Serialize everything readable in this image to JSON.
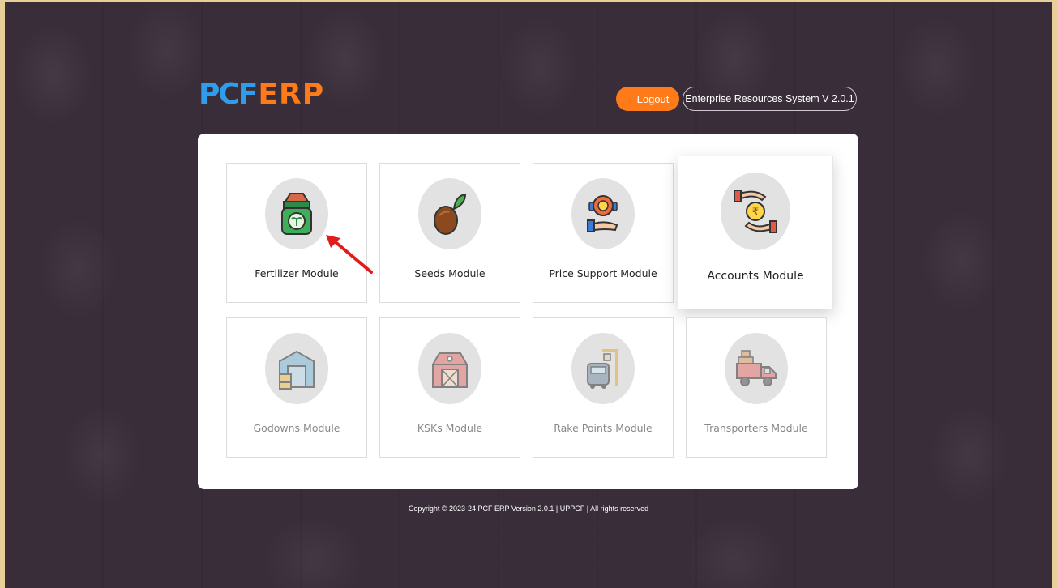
{
  "header": {
    "logo_pcf": "PCF",
    "logo_erp": "ERP",
    "logout_label": "Logout",
    "version_label": "Enterprise Resources System V 2.0.1"
  },
  "modules": [
    {
      "label": "Fertilizer Module",
      "icon": "fertilizer-bag-icon"
    },
    {
      "label": "Seeds Module",
      "icon": "seed-sprout-icon"
    },
    {
      "label": "Price Support Module",
      "icon": "price-support-icon"
    },
    {
      "label": "Accounts Module",
      "icon": "accounts-rupee-icon"
    },
    {
      "label": "Godowns Module",
      "icon": "godown-warehouse-icon"
    },
    {
      "label": "KSKs Module",
      "icon": "barn-icon"
    },
    {
      "label": "Rake Points Module",
      "icon": "rake-train-icon"
    },
    {
      "label": "Transporters Module",
      "icon": "delivery-truck-icon"
    }
  ],
  "footer": {
    "copyright": "Copyright © 2023-24 PCF ERP Version 2.0.1 | UPPCF | All rights reserved"
  },
  "colors": {
    "accent_orange": "#ff7a18",
    "logo_blue": "#2f9de8",
    "background": "#3a2d3a",
    "frame": "#e8cf98"
  }
}
